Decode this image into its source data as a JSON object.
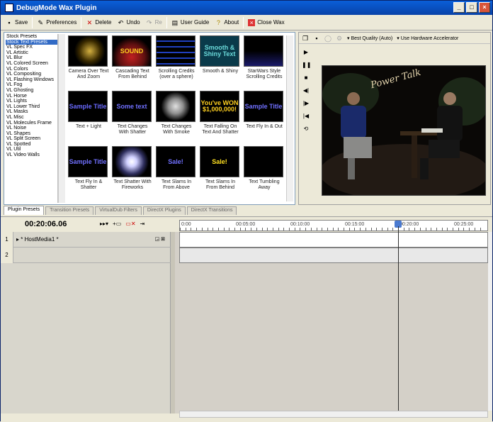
{
  "window": {
    "title": "DebugMode Wax Plugin",
    "controls": [
      "_",
      "□",
      "×"
    ]
  },
  "toolbar": {
    "save": "Save",
    "preferences": "Preferences",
    "delete": "Delete",
    "undo": "Undo",
    "redo": "Re",
    "user_guide": "User Guide",
    "about": "About",
    "close_wax": "Close Wax"
  },
  "preset_list": {
    "items": [
      "Stock Presets",
      "Stock Text Presets",
      "VL Spec FX",
      "VL Artistic",
      "VL Blur",
      "VL Colored Screen",
      "VL Colors",
      "VL Compositing",
      "VL Flashing Windows",
      "VL Fog",
      "VL Ghosting",
      "VL Horse",
      "VL Lights",
      "VL Lower Third",
      "VL Masks",
      "VL Misc",
      "VL Molecules Frame",
      "VL Noise",
      "VL Shapes",
      "VL Split Screen",
      "VL Spotted",
      "VL Util",
      "VL Video Walls"
    ],
    "selected_index": 1
  },
  "presets": [
    {
      "caption": "Camera Over Text And Zoom",
      "thumb_text": ""
    },
    {
      "caption": "Cascading Text From Behind",
      "thumb_text": "SOUND"
    },
    {
      "caption": "Scrolling Credits (over a sphere)",
      "thumb_text": ""
    },
    {
      "caption": "Smooth & Shiny",
      "thumb_text": "Smooth & Shiny Text"
    },
    {
      "caption": "StarWars Style Scrolling Credits",
      "thumb_text": ""
    },
    {
      "caption": "Text + Light",
      "thumb_text": "Sample Title"
    },
    {
      "caption": "Text Changes With Shatter",
      "thumb_text": "Some text"
    },
    {
      "caption": "Text Changes With Smoke",
      "thumb_text": ""
    },
    {
      "caption": "Text Falling On Text And Shatter",
      "thumb_text": "You've WON $1,000,000!"
    },
    {
      "caption": "Text Fly In & Out",
      "thumb_text": "Sample Title"
    },
    {
      "caption": "Text Fly In & Shatter",
      "thumb_text": "Sample Title"
    },
    {
      "caption": "Text Shatter With Fireworks",
      "thumb_text": ""
    },
    {
      "caption": "Text Slams In From Above",
      "thumb_text": "Sale!"
    },
    {
      "caption": "Text Slams In From Behind",
      "thumb_text": "Sale!"
    },
    {
      "caption": "Text Tumbling Away",
      "thumb_text": ""
    }
  ],
  "tabs": [
    "Plugin Presets",
    "Transition Presets",
    "VirtualDub Filters",
    "DirectX Plugins",
    "DirectX Transitions"
  ],
  "preview": {
    "quality": "Best Quality (Auto)",
    "accel": "Use Hardware Accelerator",
    "video_title": "Power Talk"
  },
  "timeline": {
    "timecode": "00:20:06.06",
    "ruler_labels": [
      "0:00",
      "00:05:00",
      "00:10:00",
      "00:15:00",
      "00:20:00",
      "00:25:00"
    ],
    "tracks": [
      {
        "num": "1",
        "name": "* HostMedia1 *"
      },
      {
        "num": "2",
        "name": ""
      }
    ]
  },
  "colors": {
    "titlebar": "#0a5fd8",
    "selection": "#316ac5",
    "playhead": "#4a7ad0"
  }
}
